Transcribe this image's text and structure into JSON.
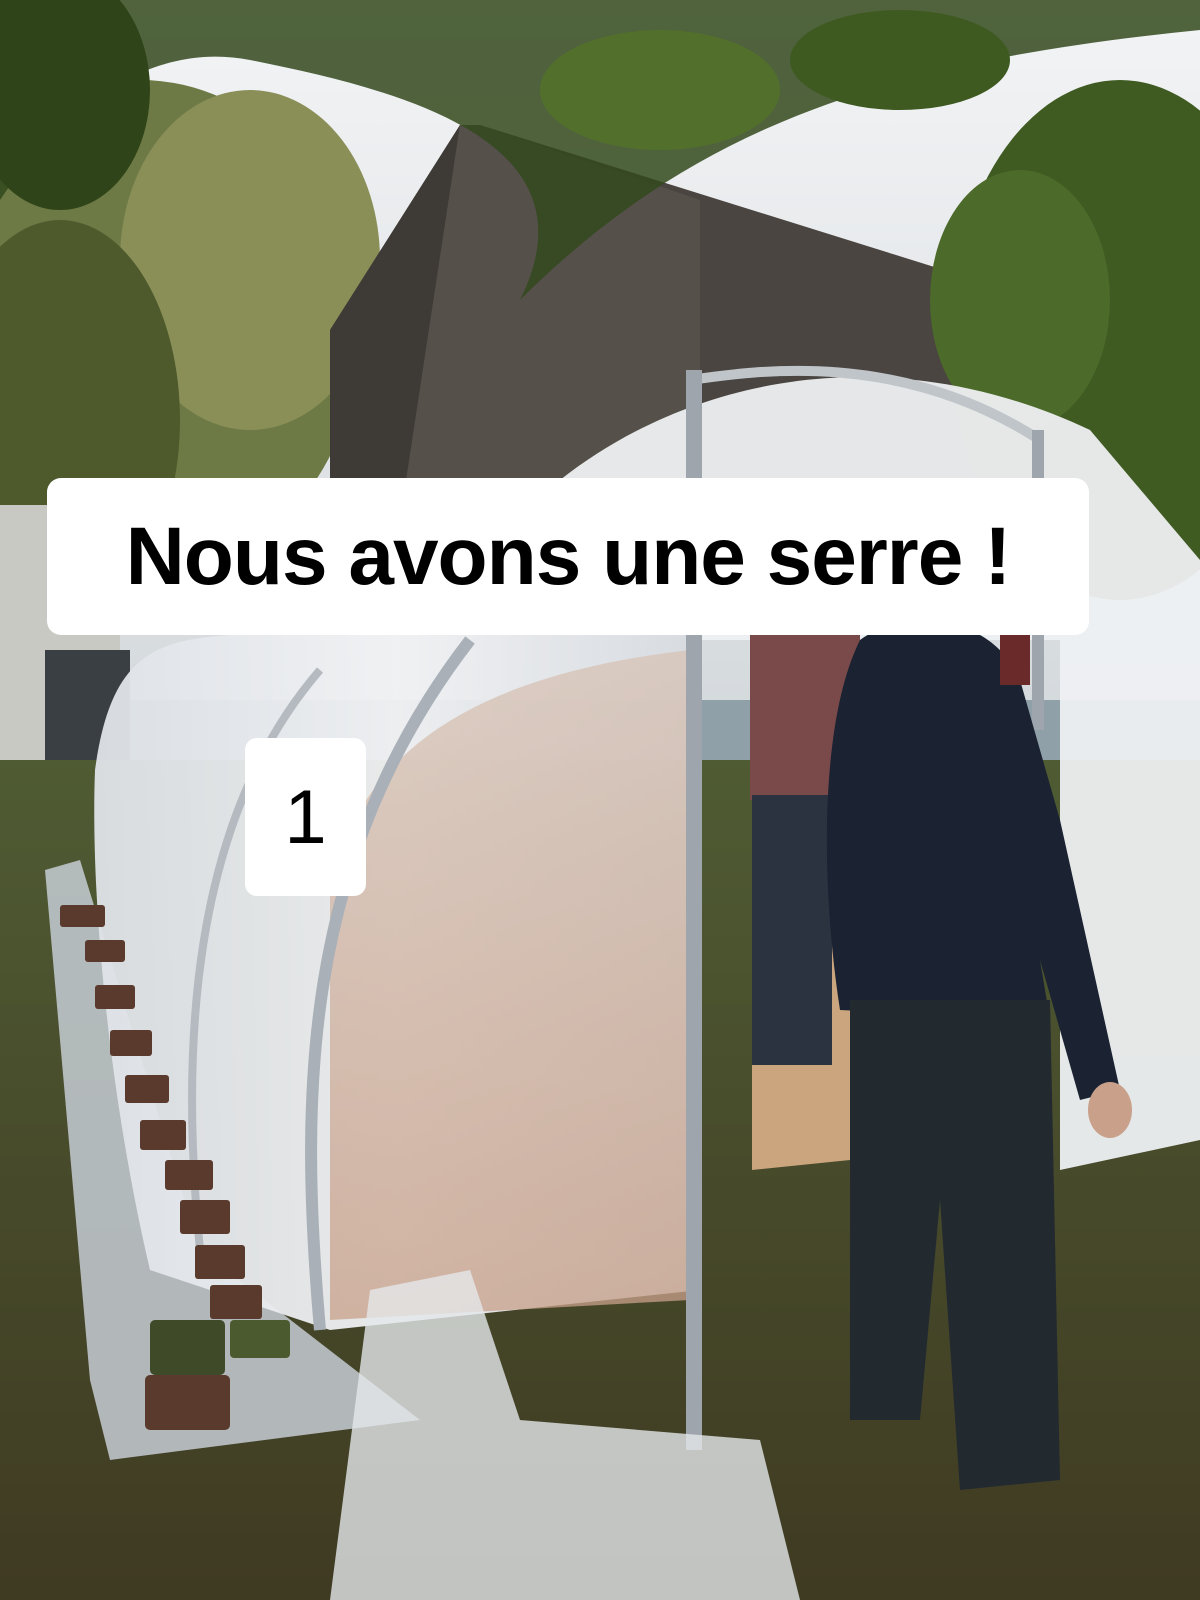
{
  "caption": {
    "title": "Nous avons une serre !",
    "counter": "1"
  },
  "scene": {
    "description_icons": [
      "greenhouse",
      "tree-branch",
      "barn-roof",
      "person",
      "bricks",
      "plastic-sheet"
    ],
    "colors": {
      "sky": "#dfe3e6",
      "grass": "#4d5a2e",
      "plastic": "#e9ecef",
      "floor_inside": "#c9a58a",
      "jacket": "#1b2333",
      "roof": "#46413c",
      "foliage": "#3d5a1f"
    }
  }
}
